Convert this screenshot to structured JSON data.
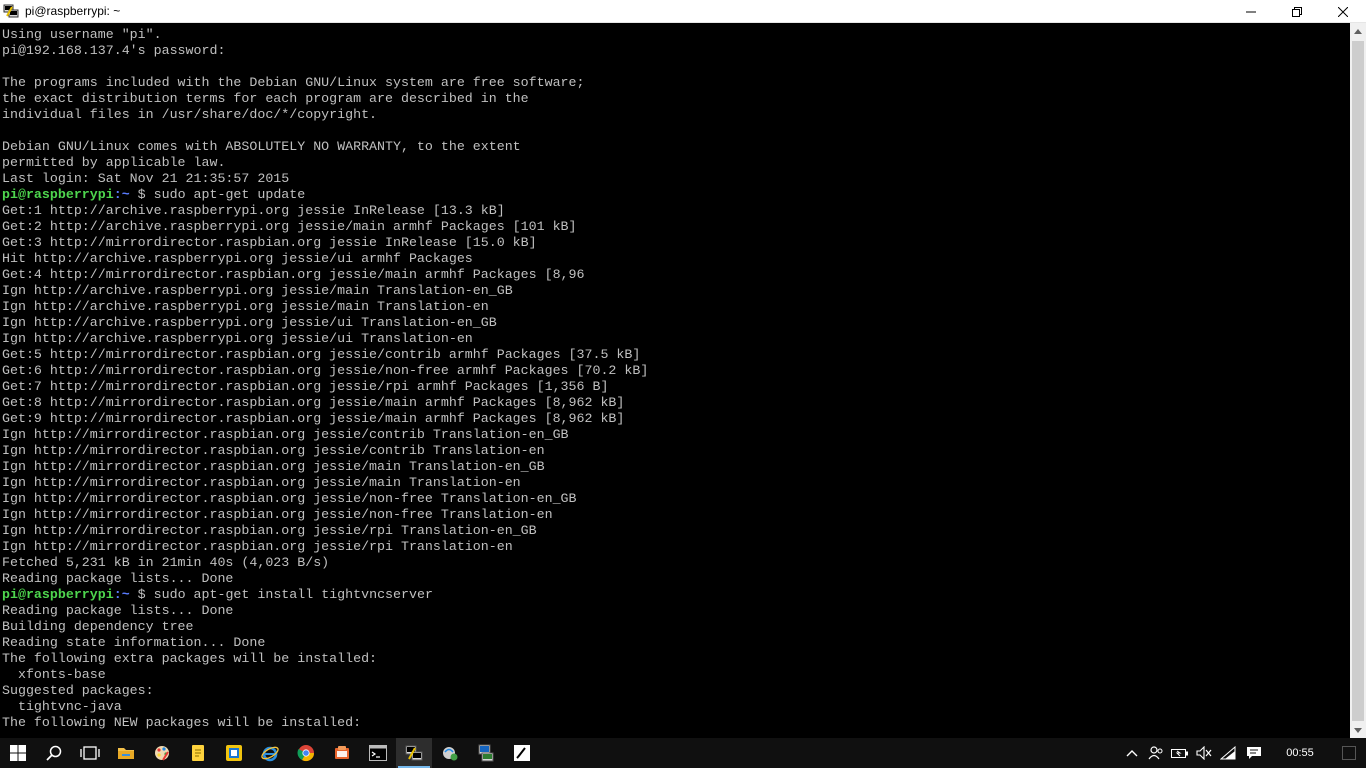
{
  "window": {
    "title": "pi@raspberrypi: ~",
    "icon": "putty-icon"
  },
  "terminal": {
    "lines": [
      {
        "text": "Using username \"pi\"."
      },
      {
        "text": "pi@192.168.137.4's password:"
      },
      {
        "text": ""
      },
      {
        "text": "The programs included with the Debian GNU/Linux system are free software;"
      },
      {
        "text": "the exact distribution terms for each program are described in the"
      },
      {
        "text": "individual files in /usr/share/doc/*/copyright."
      },
      {
        "text": ""
      },
      {
        "text": "Debian GNU/Linux comes with ABSOLUTELY NO WARRANTY, to the extent"
      },
      {
        "text": "permitted by applicable law."
      },
      {
        "text": "Last login: Sat Nov 21 21:35:57 2015"
      },
      {
        "prompt": {
          "user": "pi@raspberrypi",
          "path": ":~ ",
          "sym": "$ "
        },
        "text": "sudo apt-get update"
      },
      {
        "text": "Get:1 http://archive.raspberrypi.org jessie InRelease [13.3 kB]"
      },
      {
        "text": "Get:2 http://archive.raspberrypi.org jessie/main armhf Packages [101 kB]"
      },
      {
        "text": "Get:3 http://mirrordirector.raspbian.org jessie InRelease [15.0 kB]"
      },
      {
        "text": "Hit http://archive.raspberrypi.org jessie/ui armhf Packages"
      },
      {
        "text": "Get:4 http://mirrordirector.raspbian.org jessie/main armhf Packages [8,96"
      },
      {
        "text": "Ign http://archive.raspberrypi.org jessie/main Translation-en_GB"
      },
      {
        "text": "Ign http://archive.raspberrypi.org jessie/main Translation-en"
      },
      {
        "text": "Ign http://archive.raspberrypi.org jessie/ui Translation-en_GB"
      },
      {
        "text": "Ign http://archive.raspberrypi.org jessie/ui Translation-en"
      },
      {
        "text": "Get:5 http://mirrordirector.raspbian.org jessie/contrib armhf Packages [37.5 kB]"
      },
      {
        "text": "Get:6 http://mirrordirector.raspbian.org jessie/non-free armhf Packages [70.2 kB]"
      },
      {
        "text": "Get:7 http://mirrordirector.raspbian.org jessie/rpi armhf Packages [1,356 B]"
      },
      {
        "text": "Get:8 http://mirrordirector.raspbian.org jessie/main armhf Packages [8,962 kB]"
      },
      {
        "text": "Get:9 http://mirrordirector.raspbian.org jessie/main armhf Packages [8,962 kB]"
      },
      {
        "text": "Ign http://mirrordirector.raspbian.org jessie/contrib Translation-en_GB"
      },
      {
        "text": "Ign http://mirrordirector.raspbian.org jessie/contrib Translation-en"
      },
      {
        "text": "Ign http://mirrordirector.raspbian.org jessie/main Translation-en_GB"
      },
      {
        "text": "Ign http://mirrordirector.raspbian.org jessie/main Translation-en"
      },
      {
        "text": "Ign http://mirrordirector.raspbian.org jessie/non-free Translation-en_GB"
      },
      {
        "text": "Ign http://mirrordirector.raspbian.org jessie/non-free Translation-en"
      },
      {
        "text": "Ign http://mirrordirector.raspbian.org jessie/rpi Translation-en_GB"
      },
      {
        "text": "Ign http://mirrordirector.raspbian.org jessie/rpi Translation-en"
      },
      {
        "text": "Fetched 5,231 kB in 21min 40s (4,023 B/s)"
      },
      {
        "text": "Reading package lists... Done"
      },
      {
        "prompt": {
          "user": "pi@raspberrypi",
          "path": ":~ ",
          "sym": "$ "
        },
        "text": "sudo apt-get install tightvncserver"
      },
      {
        "text": "Reading package lists... Done"
      },
      {
        "text": "Building dependency tree"
      },
      {
        "text": "Reading state information... Done"
      },
      {
        "text": "The following extra packages will be installed:"
      },
      {
        "text": "  xfonts-base"
      },
      {
        "text": "Suggested packages:"
      },
      {
        "text": "  tightvnc-java"
      },
      {
        "text": "The following NEW packages will be installed:"
      }
    ]
  },
  "taskbar": {
    "items": [
      {
        "name": "start-button",
        "icon": "windows-icon"
      },
      {
        "name": "search-button",
        "icon": "search-icon"
      },
      {
        "name": "task-view-button",
        "icon": "task-view-icon"
      },
      {
        "name": "file-explorer-button",
        "icon": "folder-icon"
      },
      {
        "name": "paint-button",
        "icon": "paint-icon"
      },
      {
        "name": "sticky-notes-button",
        "icon": "sticky-note-icon"
      },
      {
        "name": "app-button",
        "icon": "app-window-icon"
      },
      {
        "name": "internet-explorer-button",
        "icon": "internet-explorer-icon"
      },
      {
        "name": "chrome-button",
        "icon": "chrome-icon"
      },
      {
        "name": "office-button",
        "icon": "office-icon"
      },
      {
        "name": "cmd-button",
        "icon": "cmd-icon"
      },
      {
        "name": "putty-button",
        "icon": "putty-icon",
        "active": true
      },
      {
        "name": "network-app-button",
        "icon": "network-app-icon"
      },
      {
        "name": "putty-config-button",
        "icon": "putty-config-icon"
      },
      {
        "name": "editor-button",
        "icon": "editor-icon"
      }
    ],
    "tray": {
      "icons": [
        "chevron-up-icon",
        "people-icon",
        "battery-icon",
        "volume-mute-icon",
        "wifi-icon"
      ],
      "clock": "00:55",
      "notification_icon": "notification-icon"
    }
  },
  "colors": {
    "terminal_bg": "#000000",
    "terminal_fg": "#c0c0c0",
    "prompt_user": "#4ed64e",
    "prompt_path": "#5a7cff",
    "taskbar_bg": "#101010"
  }
}
